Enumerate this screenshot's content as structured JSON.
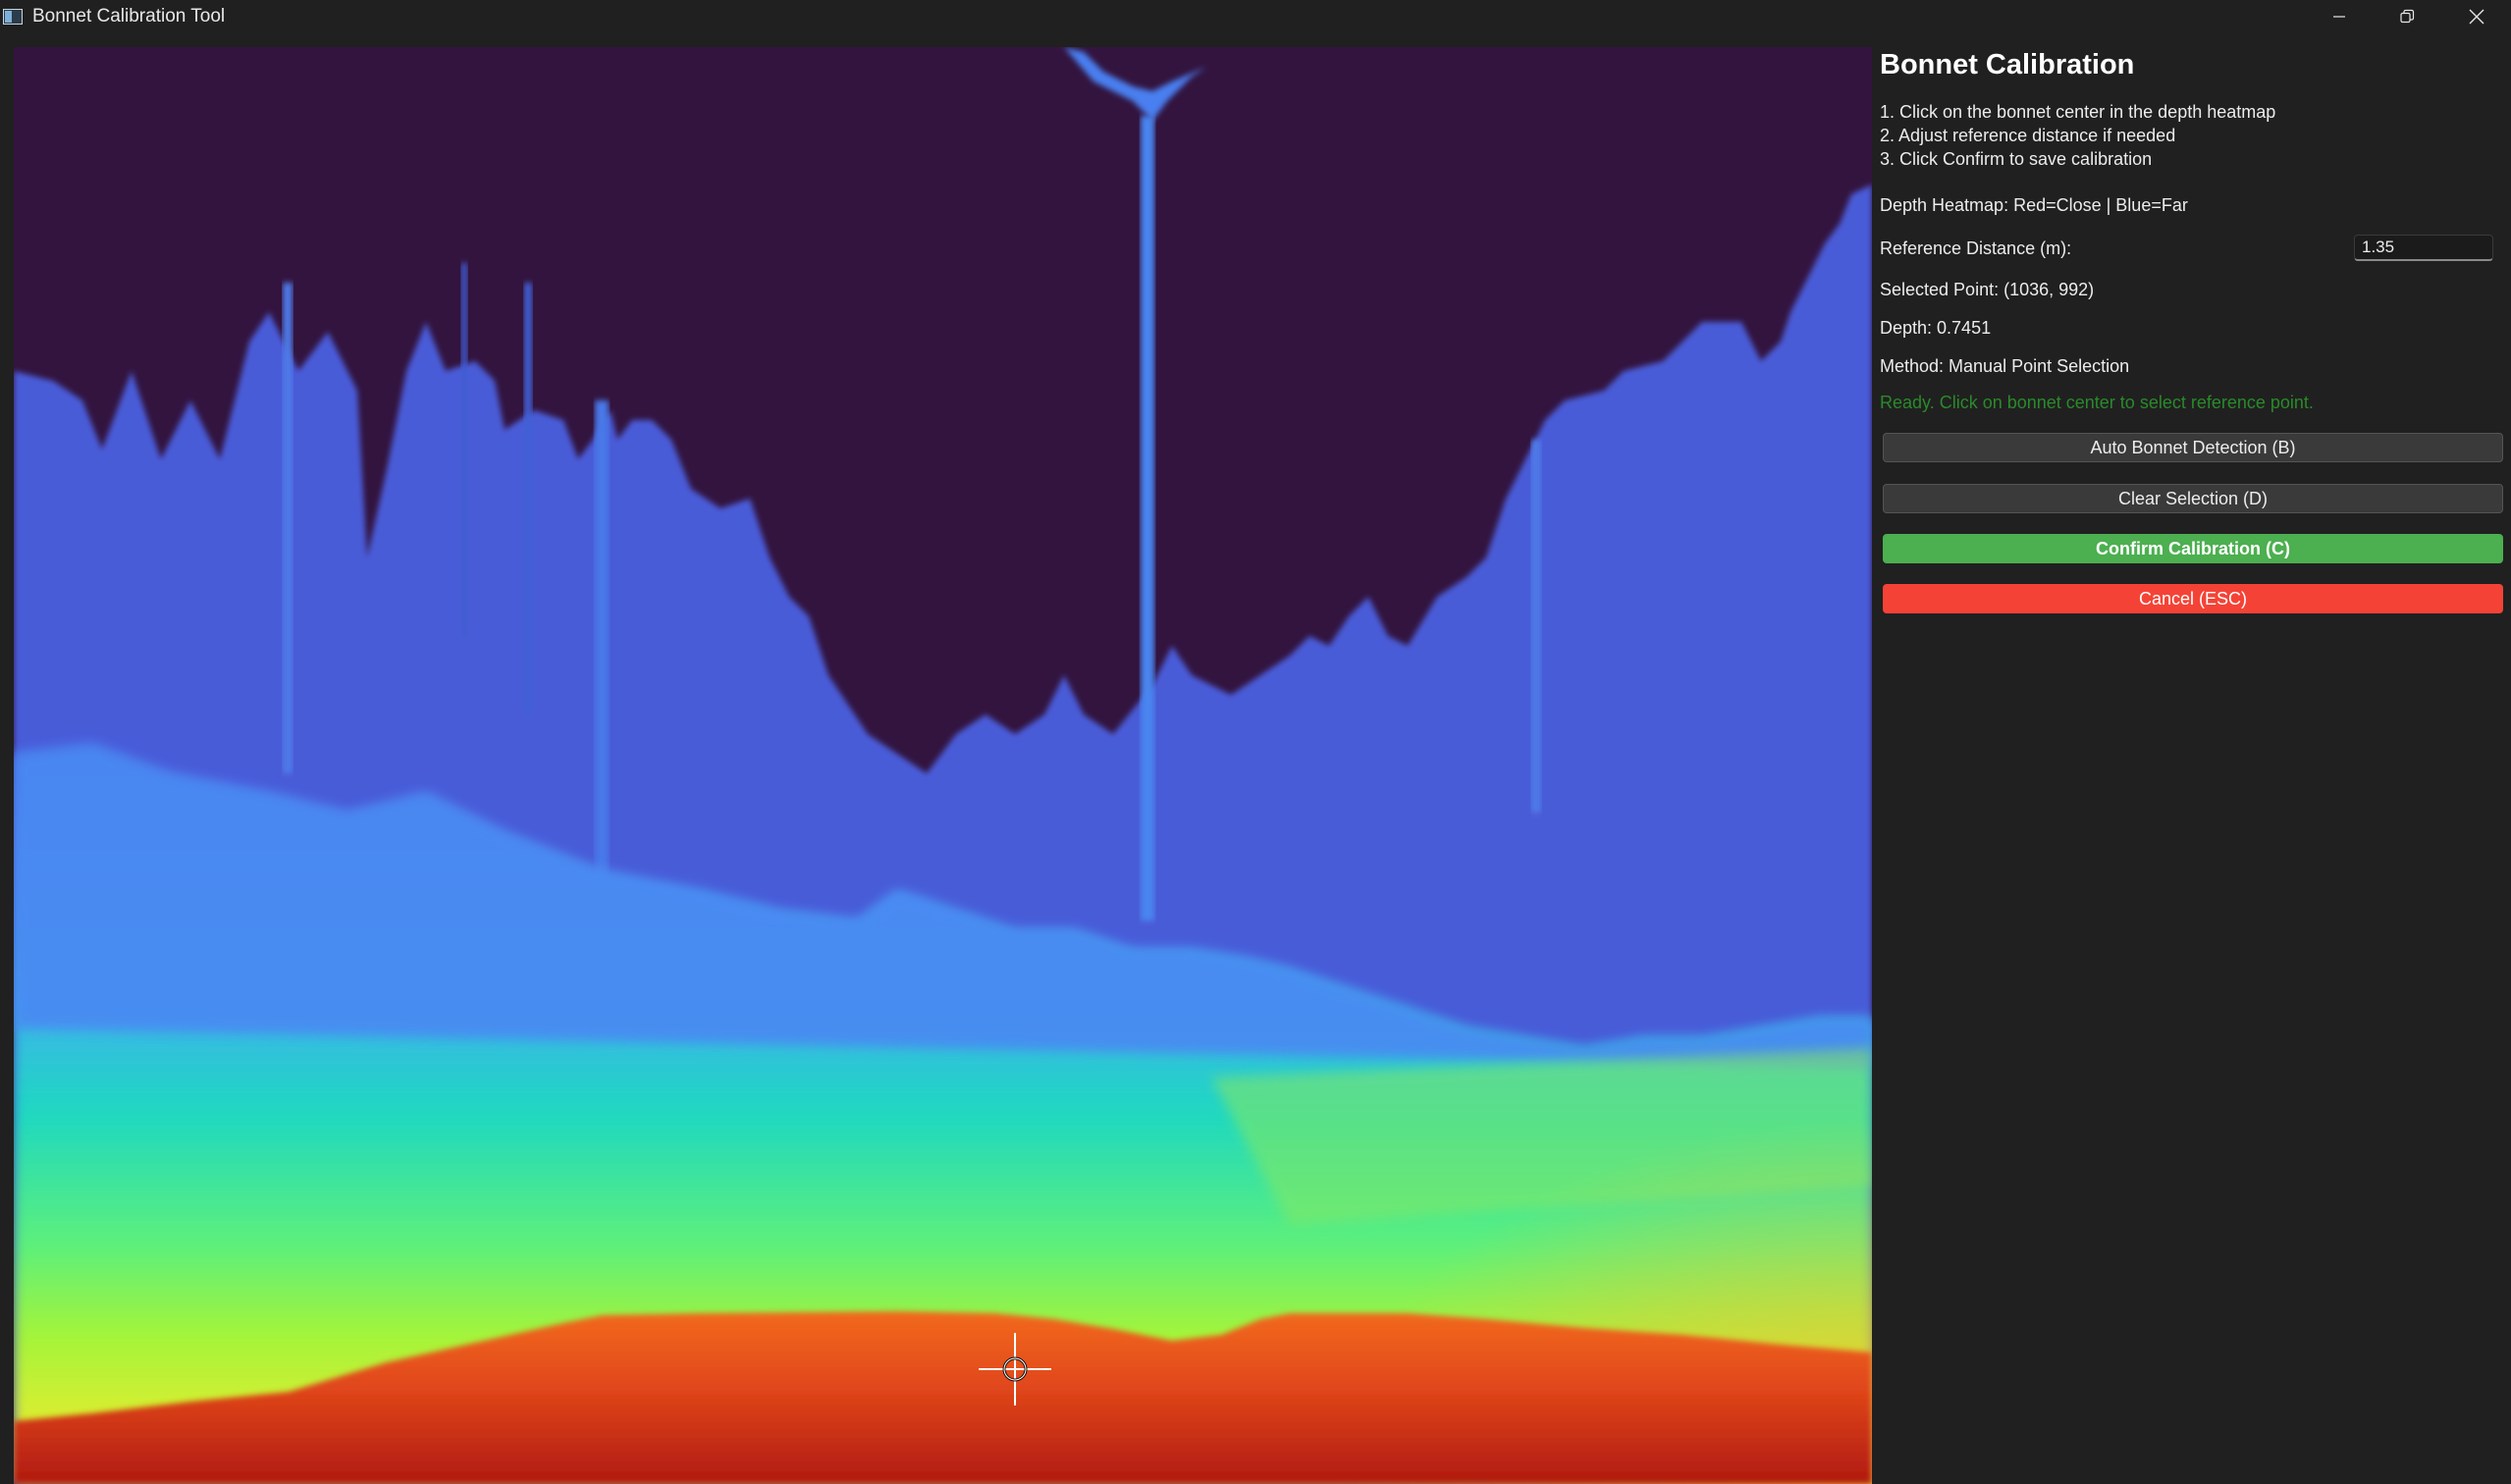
{
  "window": {
    "title": "Bonnet Calibration Tool",
    "controls": [
      "minimize-icon",
      "restore-icon",
      "close-icon"
    ]
  },
  "panel": {
    "title": "Bonnet Calibration",
    "instructions": [
      "1. Click on the bonnet center in the depth heatmap",
      "2. Adjust reference distance if needed",
      "3. Click Confirm to save calibration"
    ],
    "legend_text": "Depth Heatmap: Red=Close | Blue=Far",
    "reference_label": "Reference Distance (m):",
    "reference_value": "1.35",
    "selected_point": "Selected Point: (1036, 992)",
    "depth": "Depth: 0.7451",
    "method": "Method: Manual Point Selection",
    "status": "Ready. Click on bonnet center to select reference point.",
    "buttons": {
      "auto": "Auto Bonnet Detection (B)",
      "clear": "Clear Selection (D)",
      "confirm": "Confirm Calibration (C)",
      "cancel": "Cancel (ESC)"
    }
  },
  "colors": {
    "far": "#33143f",
    "mid_blue": "#4a7ef0",
    "cyan": "#1fd8c0",
    "green": "#8ef53a",
    "yellow": "#e3d23a",
    "close": "#e8501a",
    "confirm": "#4caf50",
    "cancel": "#f44336",
    "status_text": "#2a8a2a"
  }
}
